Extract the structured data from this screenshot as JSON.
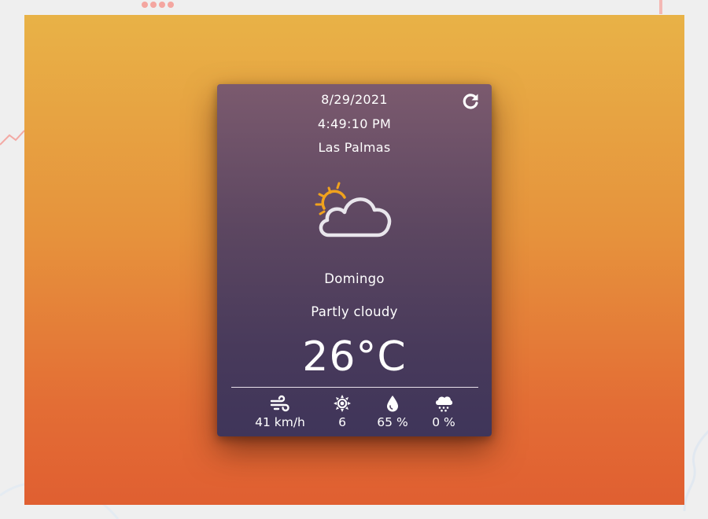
{
  "theme": {
    "background_top": "#e8b247",
    "background_bottom": "#e05f31",
    "card_top": "#7b5a6e",
    "card_bottom": "#3f355a",
    "sun_color": "#f0a21d",
    "cloud_color": "#e9e6ec"
  },
  "card": {
    "date": "8/29/2021",
    "time": "4:49:10 PM",
    "city": "Las Palmas",
    "weather_icon": "partly-cloudy-icon",
    "day": "Domingo",
    "description": "Partly cloudy",
    "temperature": "26°C",
    "refresh_icon": "refresh-icon"
  },
  "stats": {
    "wind": {
      "icon": "wind-icon",
      "value": "41 km/h"
    },
    "uv": {
      "icon": "sun-uv-icon",
      "value": "6"
    },
    "humidity": {
      "icon": "droplet-icon",
      "value": "65 %"
    },
    "precipitation": {
      "icon": "rain-cloud-icon",
      "value": "0 %"
    }
  }
}
